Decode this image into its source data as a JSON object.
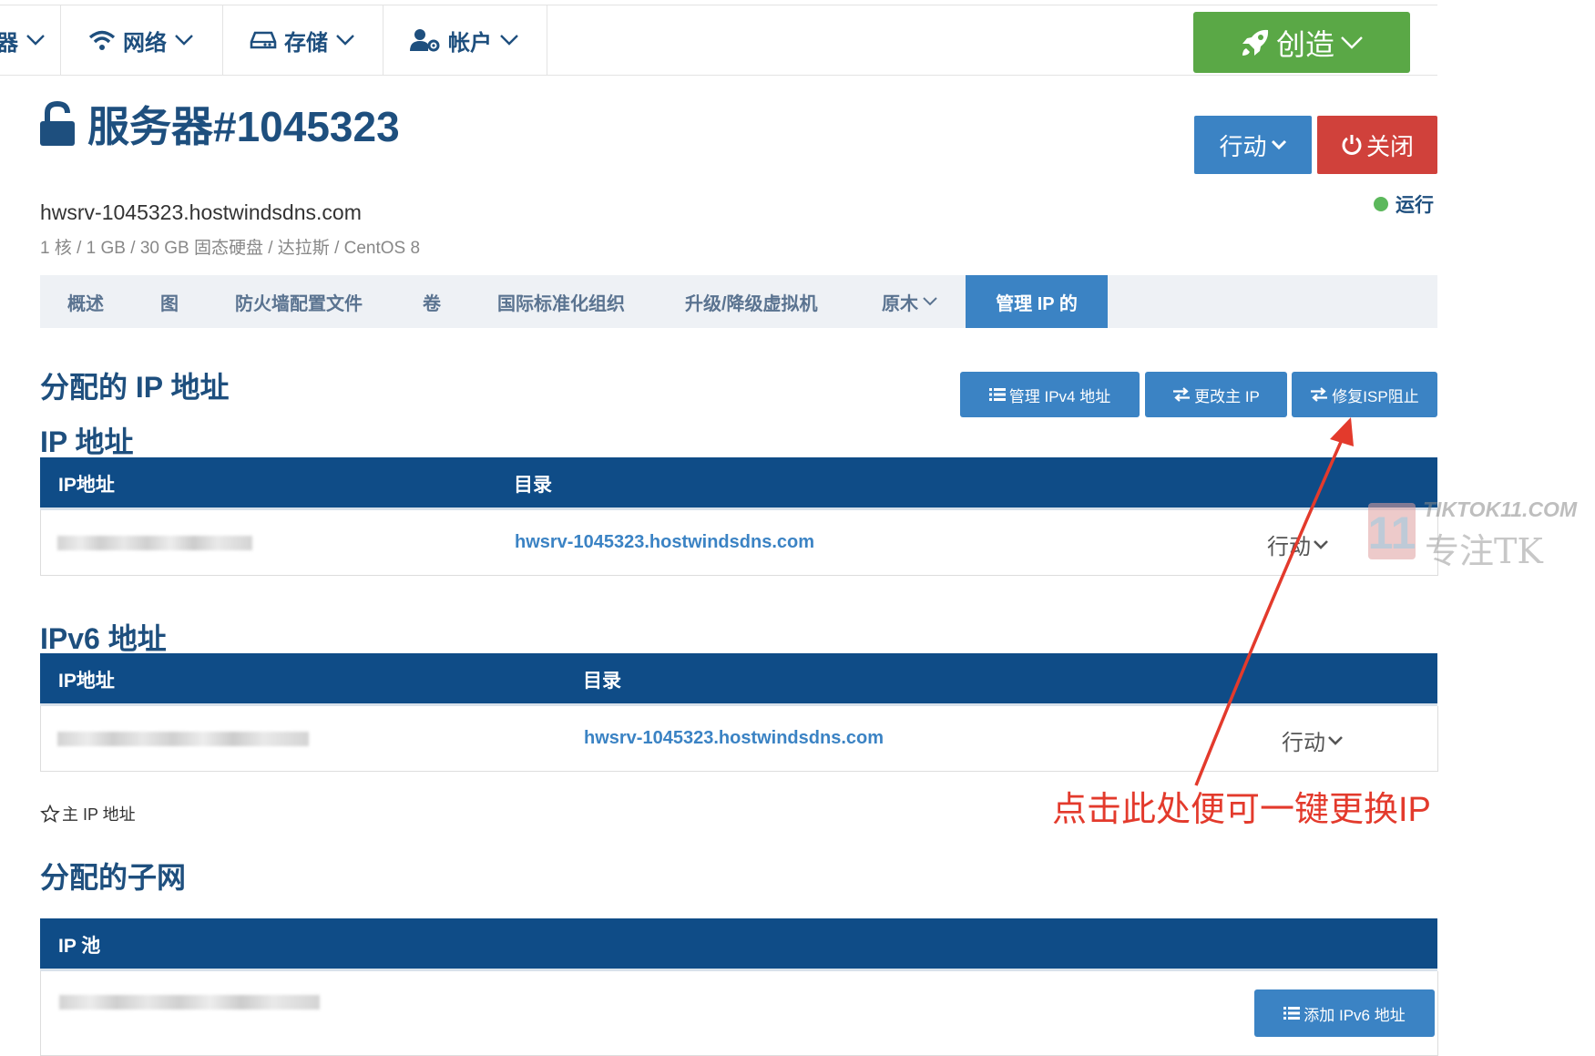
{
  "nav": {
    "partial_label": "器",
    "network": "网络",
    "storage": "存储",
    "account": "帐户",
    "create": "创造"
  },
  "server": {
    "title": "服务器#1045323",
    "hostname": "hwsrv-1045323.hostwindsdns.com",
    "specs": "1 核 / 1 GB / 30 GB 固态硬盘 / 达拉斯 / CentOS 8",
    "action_label": "行动",
    "close_label": "关闭",
    "status": "运行"
  },
  "tabs": [
    "概述",
    "图",
    "防火墙配置文件",
    "卷",
    "国际标准化组织",
    "升级/降级虚拟机",
    "原木",
    "管理 IP 的"
  ],
  "assigned": {
    "heading": "分配的 IP 地址",
    "btn_manage_ipv4": "管理 IPv4 地址",
    "btn_change_primary": "更改主 IP",
    "btn_fix_isp": "修复ISP阻止"
  },
  "ipv4": {
    "heading": "IP 地址",
    "col_ip": "IP地址",
    "col_dir": "目录",
    "row_link": "hwsrv-1045323.hostwindsdns.com",
    "row_action": "行动"
  },
  "ipv6": {
    "heading": "IPv6 地址",
    "col_ip": "IP地址",
    "col_dir": "目录",
    "row_link": "hwsrv-1045323.hostwindsdns.com",
    "row_action": "行动"
  },
  "primary_note": "主 IP 地址",
  "subnets": {
    "heading": "分配的子网",
    "col_pool": "IP 池",
    "btn_add_ipv6": "添加 IPv6 地址"
  },
  "annotation": "点击此处便可一键更换IP",
  "watermark": {
    "line1": "TIKTOK11.COM",
    "line2": "专注TK",
    "badge": "11"
  },
  "colors": {
    "brand_blue": "#1e4f7e",
    "button_blue": "#3b83c4",
    "header_navy": "#0f4c87",
    "create_green": "#5aa846",
    "close_red": "#d0413b",
    "annotation_red": "#e33a2c",
    "status_green": "#5cb85c"
  }
}
